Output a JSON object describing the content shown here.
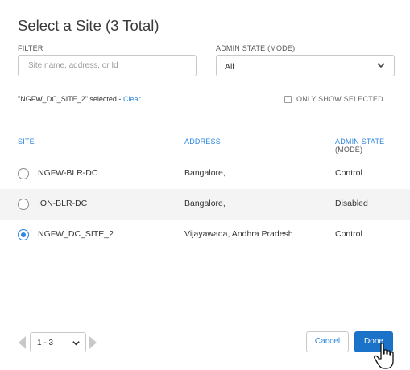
{
  "dialog": {
    "title": "Select a Site (3 Total)"
  },
  "filter": {
    "label": "FILTER",
    "placeholder": "Site name, address, or Id",
    "value": ""
  },
  "admin_state": {
    "label": "ADMIN STATE (MODE)",
    "selected": "All"
  },
  "selection": {
    "text": "\"NGFW_DC_SITE_2\" selected - ",
    "clear_label": "Clear",
    "only_show_selected_label": "ONLY SHOW SELECTED",
    "only_show_selected_checked": false
  },
  "table": {
    "headers": {
      "site": "SITE",
      "address": "ADDRESS",
      "admin_state": "ADMIN STATE",
      "admin_state_sub": "(MODE)"
    },
    "rows": [
      {
        "site": "NGFW-BLR-DC",
        "address": "Bangalore,",
        "admin_state": "Control",
        "selected": false
      },
      {
        "site": "ION-BLR-DC",
        "address": "Bangalore,",
        "admin_state": "Disabled",
        "selected": false
      },
      {
        "site": "NGFW_DC_SITE_2",
        "address": "Vijayawada, Andhra Pradesh",
        "admin_state": "Control",
        "selected": true
      }
    ]
  },
  "pagination": {
    "range": "1 - 3"
  },
  "buttons": {
    "cancel": "Cancel",
    "done": "Done"
  },
  "colors": {
    "accent": "#2e86de",
    "primary_button": "#1a73c9",
    "alt_row": "#f4f4f4"
  },
  "icons": {
    "select_chevron": "chevron-down-icon",
    "pager_prev": "triangle-left-icon",
    "pager_next": "triangle-right-icon",
    "cursor": "hand-pointer-icon"
  }
}
